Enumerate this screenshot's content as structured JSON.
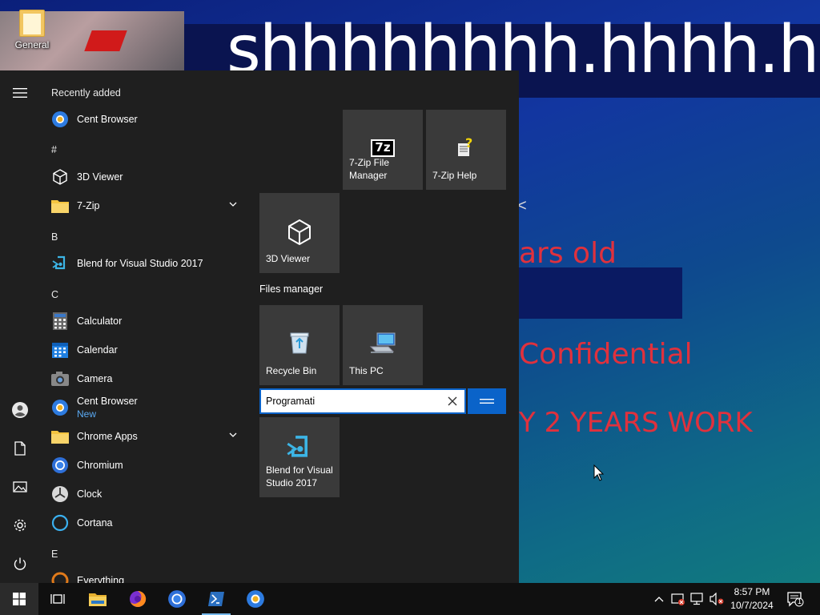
{
  "desktop": {
    "icon_general_label": "General",
    "bg_title": "shhhhhhhh.hhhh.hhhh",
    "line1": "ars old",
    "line2": "Confidential",
    "line3": "Y 2 YEARS WORK",
    "marker": "<"
  },
  "start_menu": {
    "recently_added_label": "Recently added",
    "sections": {
      "hash": "#",
      "b": "B",
      "c": "C",
      "e": "E"
    },
    "apps": {
      "recent_cent_browser": "Cent Browser",
      "viewer_3d": "3D Viewer",
      "zip7": "7-Zip",
      "blend_vs": "Blend for Visual Studio 2017",
      "calculator": "Calculator",
      "calendar": "Calendar",
      "camera": "Camera",
      "cent_browser": "Cent Browser",
      "cent_browser_badge": "New",
      "chrome_apps": "Chrome Apps",
      "chromium": "Chromium",
      "clock": "Clock",
      "cortana": "Cortana",
      "everything": "Everything"
    },
    "tiles": {
      "zip_fm": "7-Zip File Manager",
      "zip_help": "7-Zip Help",
      "viewer_3d": "3D Viewer",
      "recycle_bin": "Recycle Bin",
      "this_pc": "This PC",
      "blend_vs": "Blend for Visual Studio 2017",
      "zip_icon_text": "7z"
    },
    "group_label": "Files manager",
    "rename_value": "Programati"
  },
  "taskbar": {
    "time": "8:57 PM",
    "date": "10/7/2024",
    "notification_count": "1"
  },
  "colors": {
    "accent": "#0a63c9",
    "start_bg": "#1f1f1f",
    "tile_bg": "#3a3a3a",
    "taskbar_bg": "#101010",
    "desktop_red_text": "#e0313d"
  }
}
